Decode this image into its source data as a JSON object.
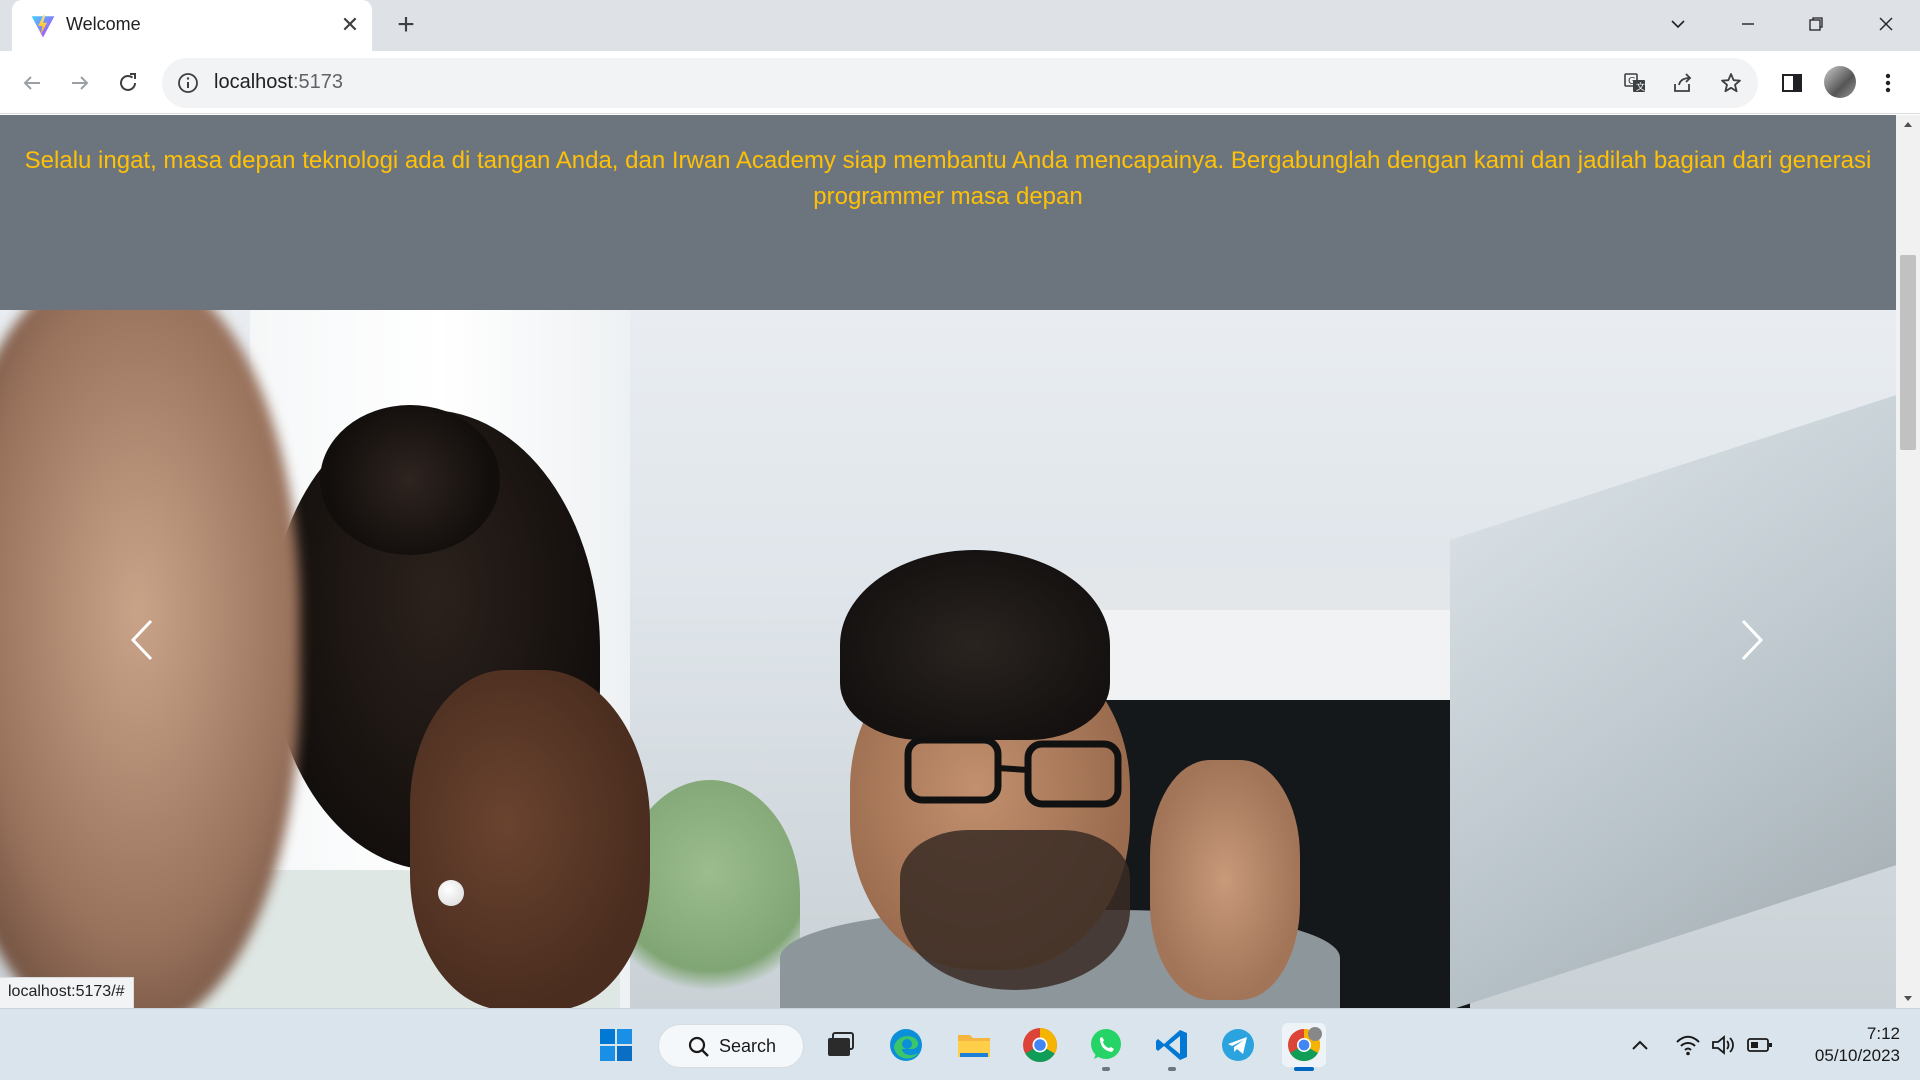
{
  "browser": {
    "tab_title": "Welcome",
    "url_host": "localhost",
    "url_port": ":5173",
    "status_url": "localhost:5173/#"
  },
  "page": {
    "banner_text": "Selalu ingat, masa depan teknologi ada di tangan Anda, dan Irwan Academy siap membantu Anda mencapainya. Bergabunglah dengan kami dan jadilah bagian dari generasi programmer masa depan",
    "banner_bg": "#6c757d",
    "banner_text_color": "#ffc107"
  },
  "taskbar": {
    "search_label": "Search",
    "time": "7:12",
    "date": "05/10/2023",
    "apps": [
      "windows-start",
      "search",
      "task-view",
      "edge",
      "file-explorer",
      "chrome",
      "whatsapp",
      "vscode",
      "telegram",
      "chrome-profile"
    ]
  }
}
